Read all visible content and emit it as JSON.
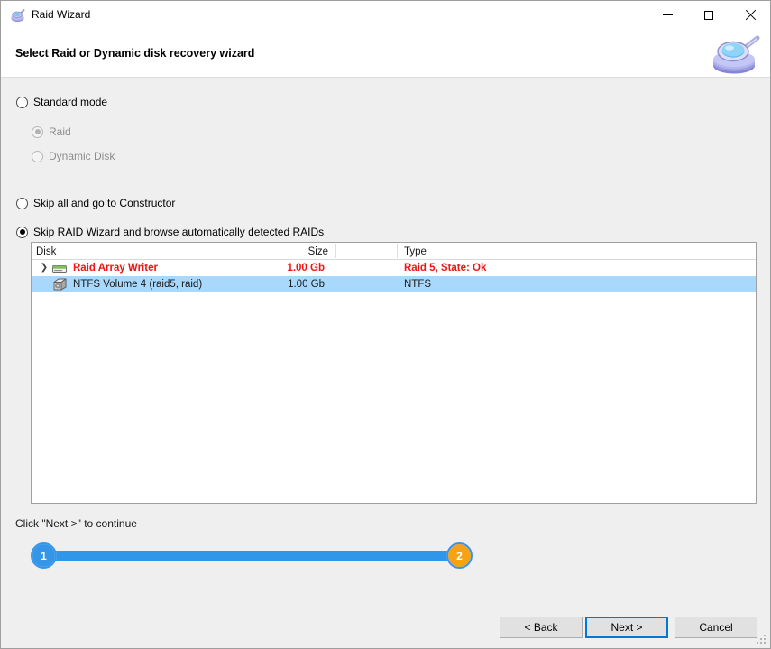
{
  "window": {
    "title": "Raid Wizard",
    "icon": "magnifier-disk-icon",
    "controls": {
      "minimize": "minimize-icon",
      "maximize": "maximize-icon",
      "close": "close-icon"
    }
  },
  "header": {
    "title": "Select Raid or Dynamic disk recovery wizard",
    "logo": "magnifier-disk-logo"
  },
  "options": {
    "standard_mode": {
      "label": "Standard mode",
      "checked": false,
      "disabled": false
    },
    "raid": {
      "label": "Raid",
      "checked": true,
      "disabled": true
    },
    "dynamic_disk": {
      "label": "Dynamic Disk",
      "checked": false,
      "disabled": true
    },
    "skip_constructor": {
      "label": "Skip all and go to Constructor",
      "checked": false,
      "disabled": false
    },
    "skip_wizard": {
      "label": "Skip RAID Wizard and browse automatically detected RAIDs",
      "checked": true,
      "disabled": false
    }
  },
  "tree": {
    "columns": [
      "Disk",
      "Size",
      "Type"
    ],
    "rows": [
      {
        "name": "Raid Array Writer",
        "size": "1.00 Gb",
        "type": "Raid 5, State: Ok",
        "icon": "raid-array-icon",
        "chevron": "chevron-down-icon",
        "level": 0,
        "style": "raid",
        "selected": false
      },
      {
        "name": "NTFS Volume 4 (raid5, raid)",
        "size": "1.00 Gb",
        "type": "NTFS",
        "icon": "volume-disk-icon",
        "chevron": "",
        "level": 1,
        "style": "volume",
        "selected": true
      }
    ]
  },
  "footer": {
    "hint": "Click \"Next >\" to continue",
    "steps": [
      {
        "number": "1",
        "state": "done"
      },
      {
        "number": "2",
        "state": "current"
      }
    ],
    "buttons": {
      "back": "< Back",
      "next": "Next >",
      "cancel": "Cancel"
    },
    "grip": "resize-grip-icon"
  },
  "colors": {
    "accent_blue": "#3596e8",
    "step_orange": "#f5a314",
    "raid_red": "#f01414",
    "selection": "#a8d8fb",
    "body_bg": "#efefef",
    "focus_border": "#0078d7"
  }
}
